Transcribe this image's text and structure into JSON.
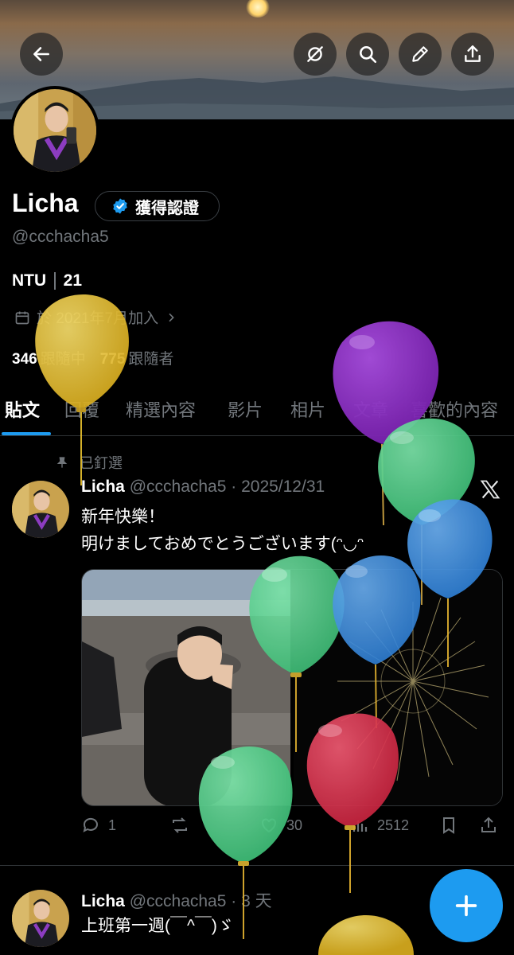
{
  "header": {
    "back_icon": "arrow-left-icon",
    "buttons": [
      "hide-icon",
      "search-icon",
      "edit-pencil-icon",
      "share-icon"
    ]
  },
  "profile": {
    "name": "Licha",
    "verified_label": "獲得認證",
    "handle": "@ccchacha5",
    "bio_parts": [
      "NTU",
      "21"
    ],
    "joined": "於 2021年7月加入",
    "following_count": "346",
    "following_label": "跟隨中",
    "followers_count": "775",
    "followers_label": "跟隨者"
  },
  "tabs": [
    "貼文",
    "回覆",
    "精選內容",
    "影片",
    "相片",
    "文章",
    "喜歡的內容"
  ],
  "pinned_label": "已釘選",
  "posts": [
    {
      "name": "Licha",
      "handle_date": "@ccchacha5 · 2025/12/31",
      "line1": "新年快樂！",
      "line2": "明けましておめでとうございます(ᵔ◡ᵔ",
      "replies": "1",
      "reposts": "",
      "likes": "30",
      "views": "2512"
    },
    {
      "name": "Licha",
      "handle_date": "@ccchacha5 · 3 天",
      "line1": "上班第一週(￣^￣)ゞ"
    }
  ],
  "colors": {
    "accent": "#1d9bf0",
    "muted": "#71767b",
    "balloon_yellow": "#e8c02e",
    "balloon_purple": "#8d2fc4",
    "balloon_green": "#4fcc8a",
    "balloon_blue": "#3d8fe0",
    "balloon_red": "#d8304e"
  }
}
